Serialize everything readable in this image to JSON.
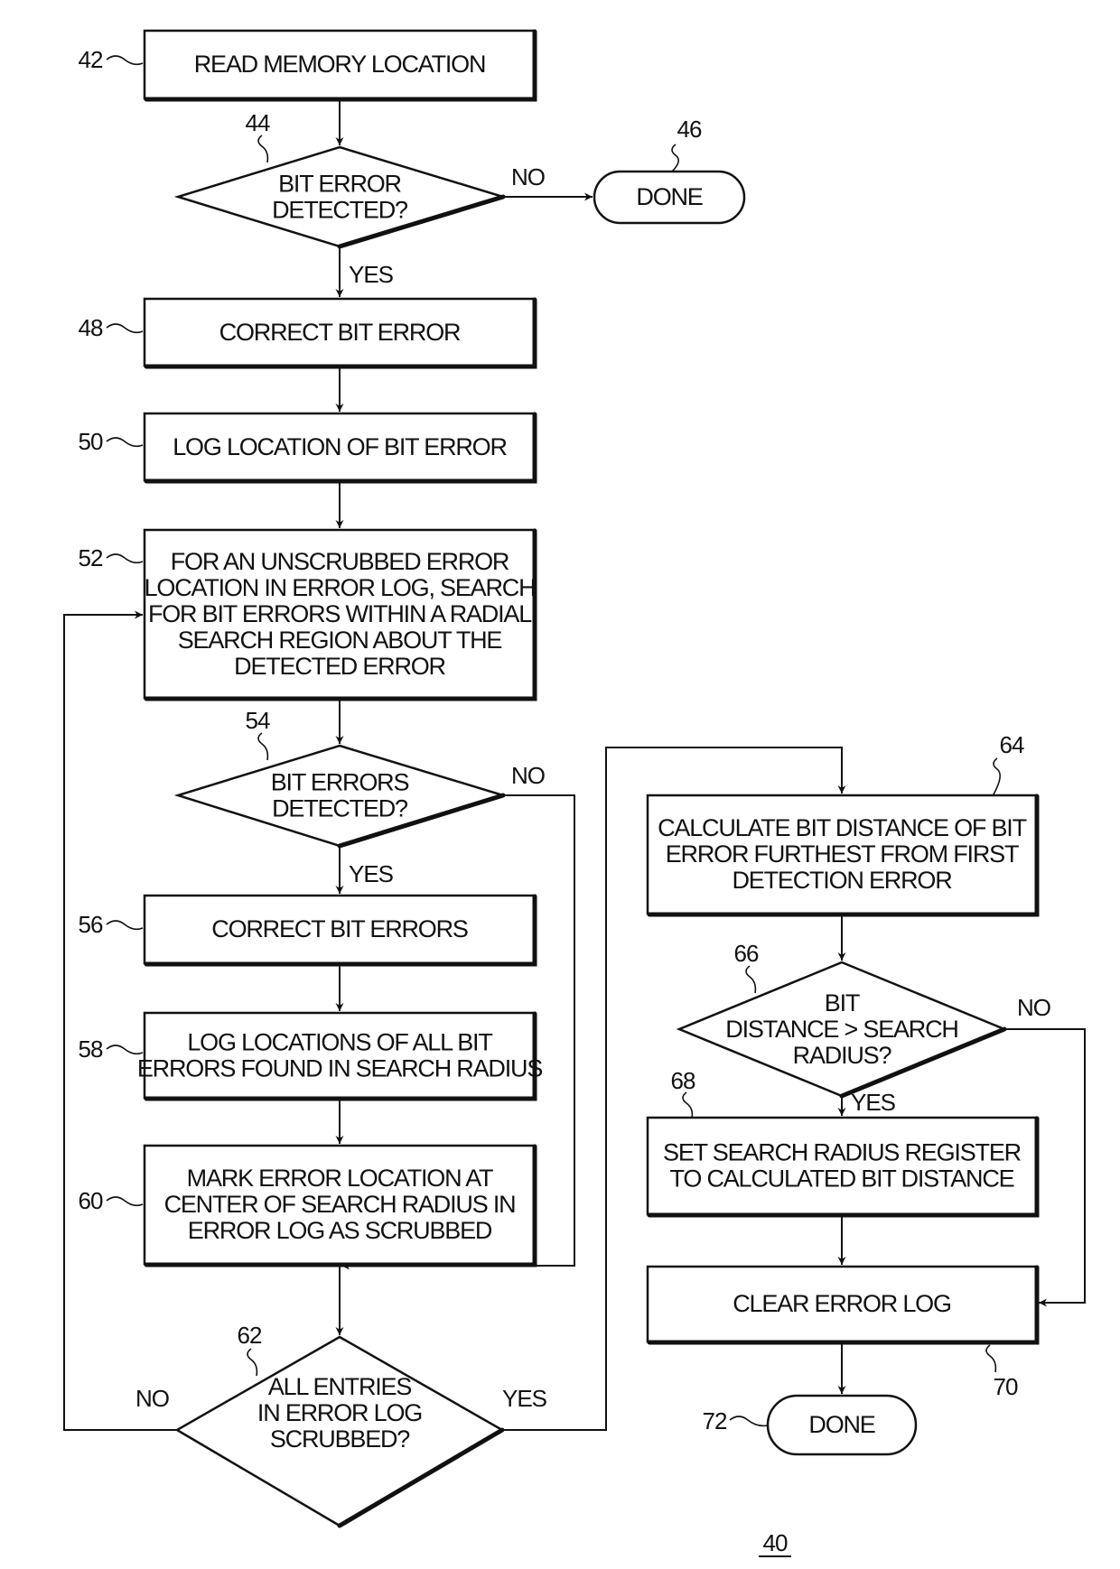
{
  "figure": {
    "number": "40",
    "colors": {
      "ink": "#111111",
      "background": "#ffffff"
    }
  },
  "nodes": {
    "n42": {
      "ref": "42",
      "type": "process",
      "lines": [
        "READ MEMORY LOCATION"
      ]
    },
    "n44": {
      "ref": "44",
      "type": "decision",
      "lines": [
        "BIT ERROR",
        "DETECTED?"
      ]
    },
    "n46": {
      "ref": "46",
      "type": "terminal",
      "lines": [
        "DONE"
      ]
    },
    "n48": {
      "ref": "48",
      "type": "process",
      "lines": [
        "CORRECT BIT ERROR"
      ]
    },
    "n50": {
      "ref": "50",
      "type": "process",
      "lines": [
        "LOG LOCATION OF BIT ERROR"
      ]
    },
    "n52": {
      "ref": "52",
      "type": "process",
      "lines": [
        "FOR AN UNSCRUBBED ERROR",
        "LOCATION IN ERROR LOG, SEARCH",
        "FOR BIT ERRORS WITHIN A RADIAL",
        "SEARCH REGION ABOUT THE",
        "DETECTED ERROR"
      ]
    },
    "n54": {
      "ref": "54",
      "type": "decision",
      "lines": [
        "BIT ERRORS",
        "DETECTED?"
      ]
    },
    "n56": {
      "ref": "56",
      "type": "process",
      "lines": [
        "CORRECT BIT ERRORS"
      ]
    },
    "n58": {
      "ref": "58",
      "type": "process",
      "lines": [
        "LOG LOCATIONS OF ALL BIT",
        "ERRORS FOUND IN SEARCH RADIUS"
      ]
    },
    "n60": {
      "ref": "60",
      "type": "process",
      "lines": [
        "MARK ERROR LOCATION AT",
        "CENTER OF SEARCH RADIUS IN",
        "ERROR LOG AS SCRUBBED"
      ]
    },
    "n62": {
      "ref": "62",
      "type": "decision",
      "lines": [
        "ALL ENTRIES",
        "IN ERROR LOG",
        "SCRUBBED?"
      ]
    },
    "n64": {
      "ref": "64",
      "type": "process",
      "lines": [
        "CALCULATE BIT DISTANCE OF BIT",
        "ERROR FURTHEST FROM FIRST",
        "DETECTION ERROR"
      ]
    },
    "n66": {
      "ref": "66",
      "type": "decision",
      "lines": [
        "BIT",
        "DISTANCE > SEARCH",
        "RADIUS?"
      ]
    },
    "n68": {
      "ref": "68",
      "type": "process",
      "lines": [
        "SET SEARCH RADIUS REGISTER",
        "TO CALCULATED BIT DISTANCE"
      ]
    },
    "n70": {
      "ref": "70",
      "type": "process",
      "lines": [
        "CLEAR ERROR LOG"
      ]
    },
    "n72": {
      "ref": "72",
      "type": "terminal",
      "lines": [
        "DONE"
      ]
    }
  },
  "edges": [
    {
      "from": "42",
      "to": "44",
      "label": ""
    },
    {
      "from": "44",
      "to": "46",
      "label": "NO"
    },
    {
      "from": "44",
      "to": "48",
      "label": "YES"
    },
    {
      "from": "48",
      "to": "50",
      "label": ""
    },
    {
      "from": "50",
      "to": "52",
      "label": ""
    },
    {
      "from": "52",
      "to": "54",
      "label": ""
    },
    {
      "from": "54",
      "to": "56",
      "label": "YES"
    },
    {
      "from": "54",
      "to": "62",
      "label": "NO"
    },
    {
      "from": "56",
      "to": "58",
      "label": ""
    },
    {
      "from": "58",
      "to": "60",
      "label": ""
    },
    {
      "from": "60",
      "to": "62",
      "label": ""
    },
    {
      "from": "62",
      "to": "52",
      "label": "NO"
    },
    {
      "from": "62",
      "to": "64",
      "label": "YES"
    },
    {
      "from": "64",
      "to": "66",
      "label": ""
    },
    {
      "from": "66",
      "to": "68",
      "label": "YES"
    },
    {
      "from": "66",
      "to": "70",
      "label": "NO"
    },
    {
      "from": "68",
      "to": "70",
      "label": ""
    },
    {
      "from": "70",
      "to": "72",
      "label": ""
    }
  ],
  "edge_labels": {
    "e44_no": "NO",
    "e44_yes": "YES",
    "e54_no": "NO",
    "e54_yes": "YES",
    "e62_no": "NO",
    "e62_yes": "YES",
    "e66_no": "NO",
    "e66_yes": "YES"
  }
}
